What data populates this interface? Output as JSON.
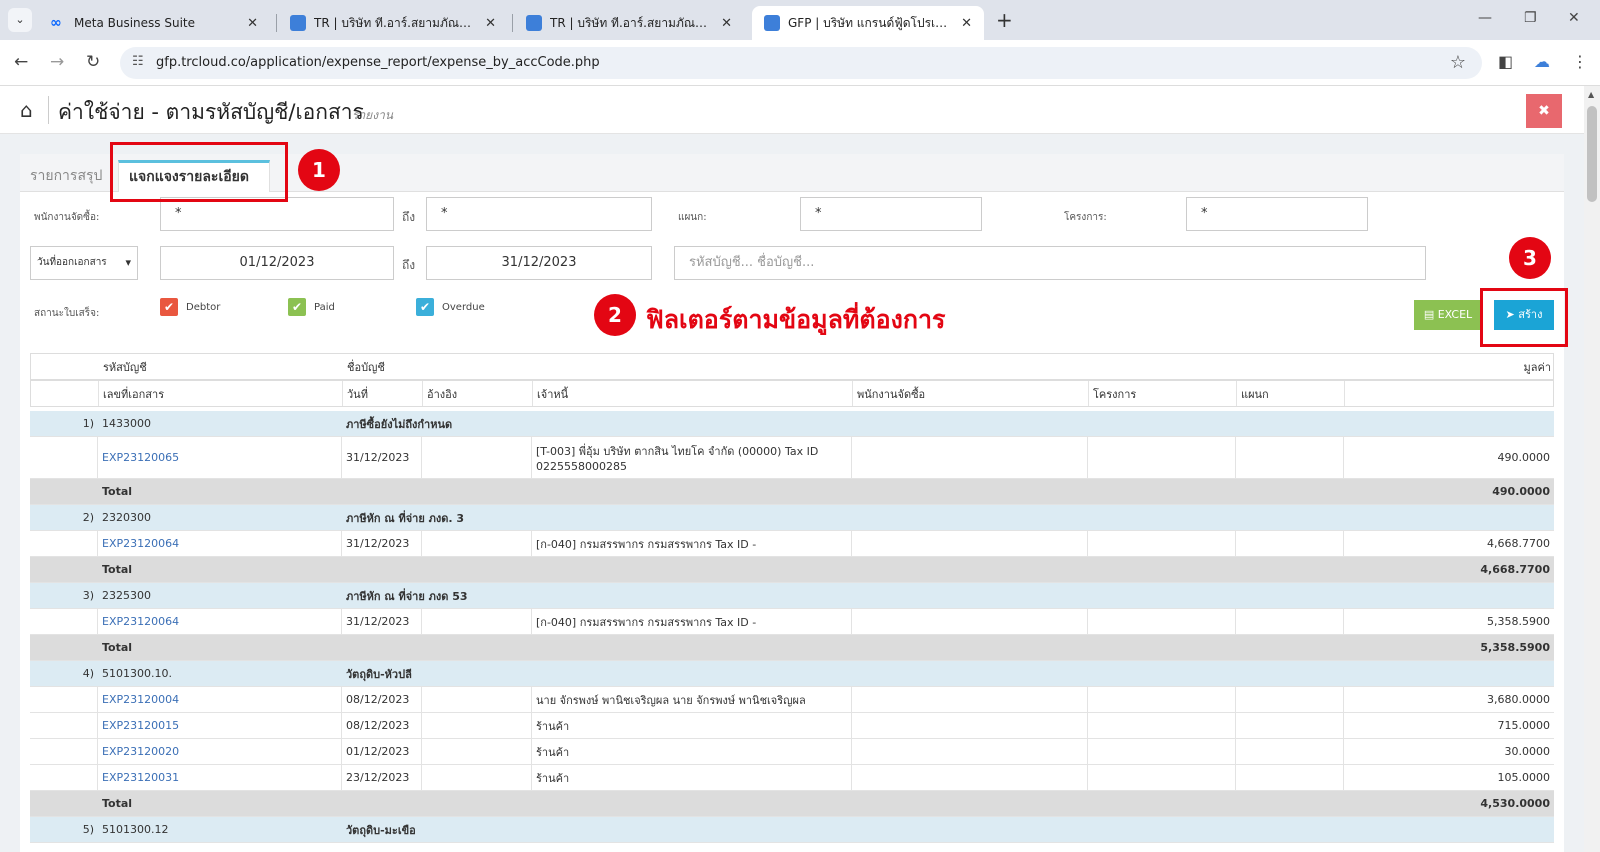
{
  "browser": {
    "tabs": [
      {
        "title": "Meta Business Suite",
        "close": "✕"
      },
      {
        "title": "TR | บริษัท ที.อาร์.สยามภัณฑ์ จำกัด",
        "close": "✕"
      },
      {
        "title": "TR | บริษัท ที.อาร์.สยามภัณฑ์ จำกัด",
        "close": "✕"
      },
      {
        "title": "GFP | บริษัท แกรนด์ฟู้ดโปรเซสซิ่ง (ป",
        "close": "✕"
      }
    ],
    "new_tab": "+",
    "url": "gfp.trcloud.co/application/expense_report/expense_by_accCode.php",
    "icons": {
      "menu": "chevron-down-icon",
      "back": "arrow-left-icon",
      "forward": "arrow-right-icon",
      "reload": "reload-icon",
      "site": "tune-icon",
      "star": "star-icon",
      "sidepanel": "sidepanel-icon",
      "cloud": "cloud-icon",
      "more": "kebab-icon"
    },
    "colors": {
      "meta_blue": "#0866ff",
      "cloud_blue": "#3d7fd9"
    }
  },
  "header": {
    "title": "ค่าใช้จ่าย - ตามรหัสบัญชี/เอกสาร",
    "subtitle": "รายงาน",
    "close": "✖"
  },
  "tabs": {
    "summary": "รายการสรุป",
    "detail": "แจกแจงรายละเอียด"
  },
  "filters": {
    "purchaser_label": "พนักงานจัดซื้อ:",
    "purchaser_value": "*",
    "to1": "ถึง",
    "to1_value": "*",
    "dept_label": "แผนก:",
    "dept_value": "*",
    "project_label": "โครงการ:",
    "project_value": "*",
    "date_type": "วันที่ออกเอกสาร",
    "date_from": "01/12/2023",
    "to2": "ถึง",
    "date_to": "31/12/2023",
    "account_placeholder": "รหัสบัญชี... ชื่อบัญชี...",
    "status_label": "สถานะใบเสร็จ:",
    "statuses": [
      {
        "label": "Debtor",
        "color": "#e9573f"
      },
      {
        "label": "Paid",
        "color": "#8cc152"
      },
      {
        "label": "Overdue",
        "color": "#3bafda"
      }
    ],
    "excel": "EXCEL",
    "create": "สร้าง"
  },
  "annotations": {
    "step1": "1",
    "step2": "2",
    "step3": "3",
    "note": "ฟิลเตอร์ตามข้อมูลที่ต้องการ",
    "color": "#e30613"
  },
  "table": {
    "header1": {
      "code": "รหัสบัญชี",
      "name": "ชื่อบัญชี",
      "value": "มูลค่า"
    },
    "header2": {
      "doc": "เลขที่เอกสาร",
      "date": "วันที่",
      "ref": "อ้างอิง",
      "creditor": "เจ้าหนี้",
      "purchaser": "พนักงานจัดซื้อ",
      "project": "โครงการ",
      "dept": "แผนก"
    },
    "total_label": "Total",
    "groups": [
      {
        "no": "1)",
        "code": "1433000",
        "name": "ภาษีซื้อยังไม่ถึงกำหนด",
        "rows": [
          {
            "doc": "EXP23120065",
            "date": "31/12/2023",
            "creditor": "[T-003] พี่อุ้ม บริษัท ตากสิน ไทยโค จำกัด (00000) Tax ID 0225558000285",
            "value": "490.0000"
          }
        ],
        "total": "490.0000"
      },
      {
        "no": "2)",
        "code": "2320300",
        "name": "ภาษีหัก ณ ที่จ่าย ภงด. 3",
        "rows": [
          {
            "doc": "EXP23120064",
            "date": "31/12/2023",
            "creditor": "[ก-040] กรมสรรพากร กรมสรรพากร Tax ID -",
            "value": "4,668.7700"
          }
        ],
        "total": "4,668.7700"
      },
      {
        "no": "3)",
        "code": "2325300",
        "name": "ภาษีหัก ณ ที่จ่าย ภงด 53",
        "rows": [
          {
            "doc": "EXP23120064",
            "date": "31/12/2023",
            "creditor": "[ก-040] กรมสรรพากร กรมสรรพากร Tax ID -",
            "value": "5,358.5900"
          }
        ],
        "total": "5,358.5900"
      },
      {
        "no": "4)",
        "code": "5101300.10.",
        "name": "วัตถุดิบ-หัวปลี",
        "rows": [
          {
            "doc": "EXP23120004",
            "date": "08/12/2023",
            "creditor": "นาย จักรพงษ์ พานิชเจริญผล นาย จักรพงษ์ พานิชเจริญผล",
            "value": "3,680.0000"
          },
          {
            "doc": "EXP23120015",
            "date": "08/12/2023",
            "creditor": "ร้านค้า",
            "value": "715.0000"
          },
          {
            "doc": "EXP23120020",
            "date": "01/12/2023",
            "creditor": "ร้านค้า",
            "value": "30.0000"
          },
          {
            "doc": "EXP23120031",
            "date": "23/12/2023",
            "creditor": "ร้านค้า",
            "value": "105.0000"
          }
        ],
        "total": "4,530.0000"
      },
      {
        "no": "5)",
        "code": "5101300.12",
        "name": "วัตถุดิบ-มะเขือ",
        "rows": [],
        "total": ""
      }
    ]
  }
}
